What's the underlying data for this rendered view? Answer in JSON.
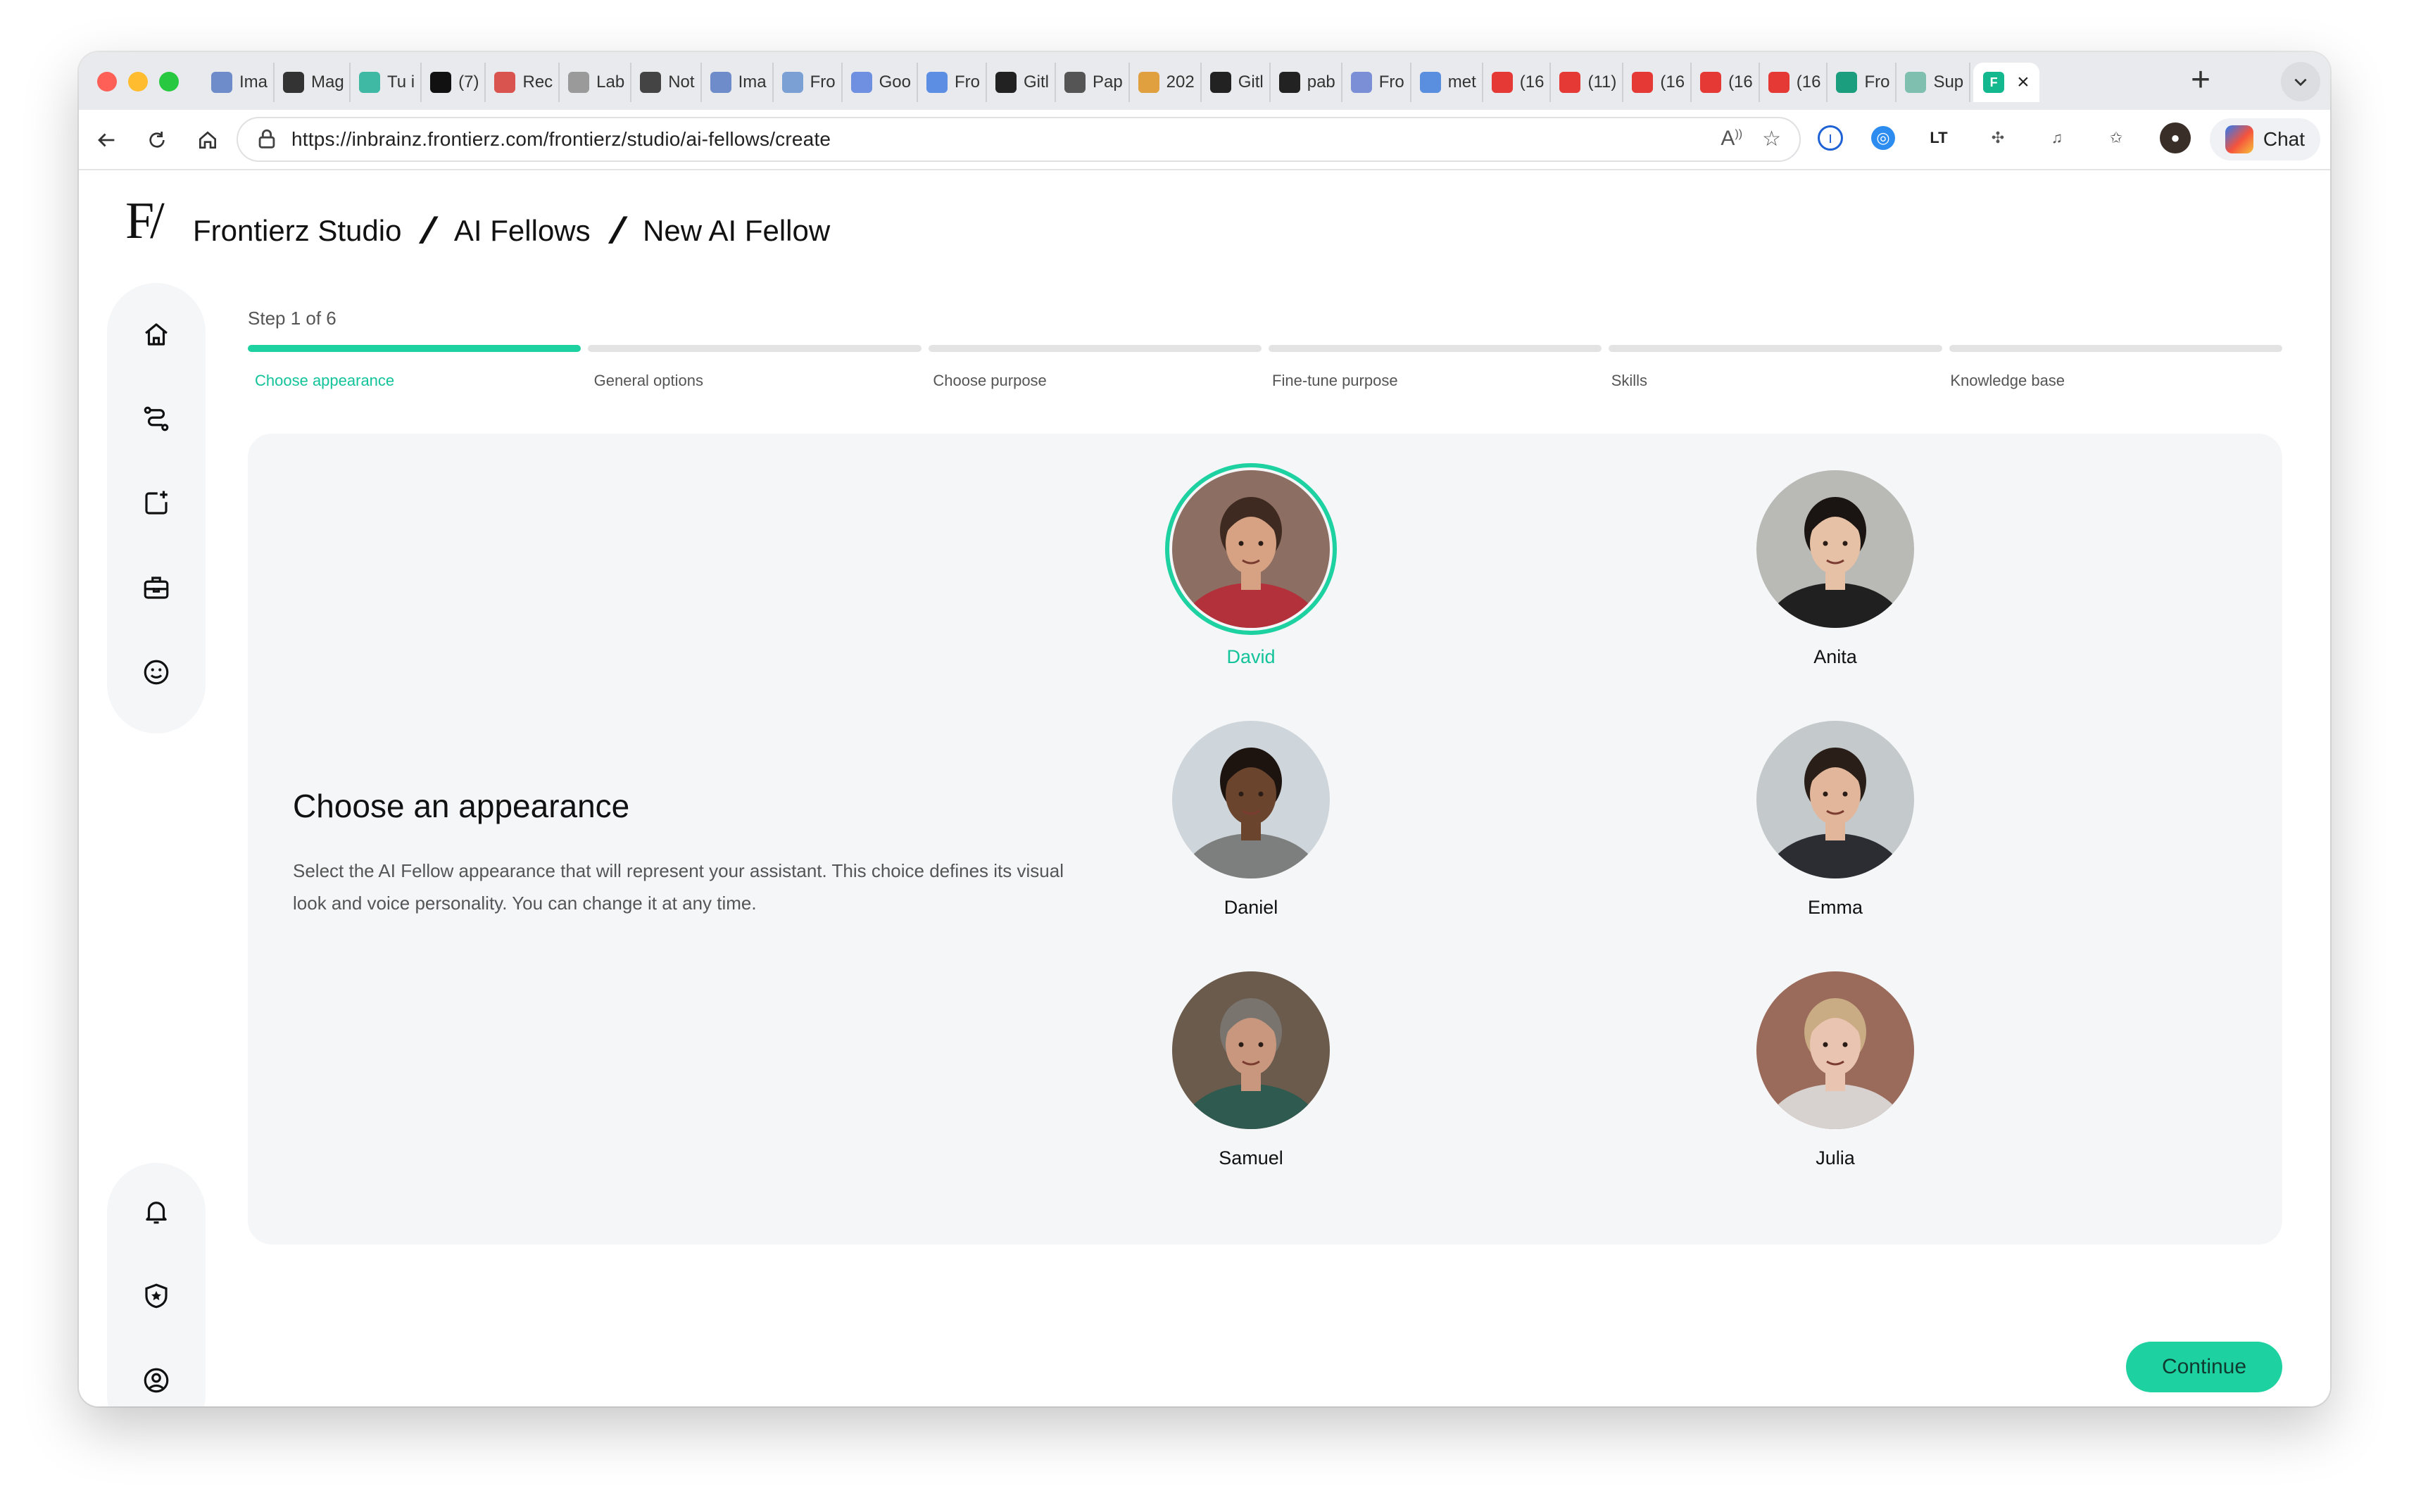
{
  "browser": {
    "tabs": [
      {
        "label": "Ima",
        "icon": "doc-icon",
        "color": "#6e8cc9"
      },
      {
        "label": "Mag",
        "icon": "triangle-icon",
        "color": "#333333"
      },
      {
        "label": "Tu i",
        "icon": "frontierz-icon",
        "color": "#3fb8a4"
      },
      {
        "label": "(7)",
        "icon": "x-logo-icon",
        "color": "#111111"
      },
      {
        "label": "Rec",
        "icon": "gmail-icon",
        "color": "#d9534f"
      },
      {
        "label": "Lab",
        "icon": "arrow-icon",
        "color": "#9a9a9a"
      },
      {
        "label": "Not",
        "icon": "openai-icon",
        "color": "#444444"
      },
      {
        "label": "Ima",
        "icon": "doc-icon",
        "color": "#6e8cc9"
      },
      {
        "label": "Fro",
        "icon": "frontierz-icon",
        "color": "#7aa0d4"
      },
      {
        "label": "Goo",
        "icon": "gemini-icon",
        "color": "#6f8fe0"
      },
      {
        "label": "Fro",
        "icon": "drive-icon",
        "color": "#5c8fe3"
      },
      {
        "label": "Gitl",
        "icon": "github-icon",
        "color": "#222222"
      },
      {
        "label": "Pap",
        "icon": "paper-icon",
        "color": "#555555"
      },
      {
        "label": "202",
        "icon": "grid-icon",
        "color": "#e0a040"
      },
      {
        "label": "Gitl",
        "icon": "github-icon",
        "color": "#222222"
      },
      {
        "label": "pab",
        "icon": "github-icon",
        "color": "#222222"
      },
      {
        "label": "Fro",
        "icon": "tool-icon",
        "color": "#7a8fd6"
      },
      {
        "label": "met",
        "icon": "chart-icon",
        "color": "#5a8fe0"
      },
      {
        "label": "(16",
        "icon": "youtube-icon",
        "color": "#e53935"
      },
      {
        "label": "(11)",
        "icon": "youtube-icon",
        "color": "#e53935"
      },
      {
        "label": "(16",
        "icon": "youtube-icon",
        "color": "#e53935"
      },
      {
        "label": "(16",
        "icon": "youtube-icon",
        "color": "#e53935"
      },
      {
        "label": "(16",
        "icon": "youtube-icon",
        "color": "#e53935"
      },
      {
        "label": "Fro",
        "icon": "frontierz-icon",
        "color": "#1a9e7d"
      },
      {
        "label": "Sup",
        "icon": "frontierz-icon",
        "color": "#7fbfb0"
      }
    ],
    "active_tab_icon": "frontierz-icon",
    "url": "https://inbrainz.frontierz.com/frontierz/studio/ai-fellows/create",
    "chat_label": "Chat"
  },
  "header": {
    "logo": "F/",
    "breadcrumb": [
      "Frontierz Studio",
      "AI Fellows",
      "New AI Fellow"
    ]
  },
  "sidebar": {
    "top_icons": [
      "home-icon",
      "route-icon",
      "new-item-icon",
      "briefcase-icon",
      "smiley-icon"
    ],
    "bottom_icons": [
      "bell-icon",
      "shield-star-icon",
      "user-circle-icon"
    ]
  },
  "wizard": {
    "step_text": "Step 1 of 6",
    "current_step": 1,
    "steps": [
      "Choose appearance",
      "General options",
      "Choose purpose",
      "Fine-tune purpose",
      "Skills",
      "Knowledge base"
    ]
  },
  "panel": {
    "title": "Choose an appearance",
    "description": "Select the AI Fellow appearance that will represent your assistant. This choice defines its visual look and voice personality. You can change it at any time."
  },
  "avatars": [
    {
      "name": "David",
      "selected": true,
      "bg": "#8d6e63",
      "skin": "#d6a283",
      "hair": "#3e2a20",
      "shirt": "#b3313a"
    },
    {
      "name": "Anita",
      "selected": false,
      "bg": "#b9b9b5",
      "skin": "#e6c1a5",
      "hair": "#1a1512",
      "shirt": "#202020"
    },
    {
      "name": "Daniel",
      "selected": false,
      "bg": "#cfd6db",
      "skin": "#6a442d",
      "hair": "#1d1410",
      "shirt": "#7d7f7e"
    },
    {
      "name": "Emma",
      "selected": false,
      "bg": "#c4c9cc",
      "skin": "#e2b69a",
      "hair": "#2a1f18",
      "shirt": "#2b2d33"
    },
    {
      "name": "Samuel",
      "selected": false,
      "bg": "#6b5b4c",
      "skin": "#c9977d",
      "hair": "#7a746f",
      "shirt": "#2f5a50"
    },
    {
      "name": "Julia",
      "selected": false,
      "bg": "#9a6a5b",
      "skin": "#e9c4b0",
      "hair": "#c9ab84",
      "shirt": "#d7d2cf"
    }
  ],
  "actions": {
    "continue_label": "Continue"
  },
  "colors": {
    "accent": "#1dd1a1",
    "accent_text": "#13c39a"
  }
}
